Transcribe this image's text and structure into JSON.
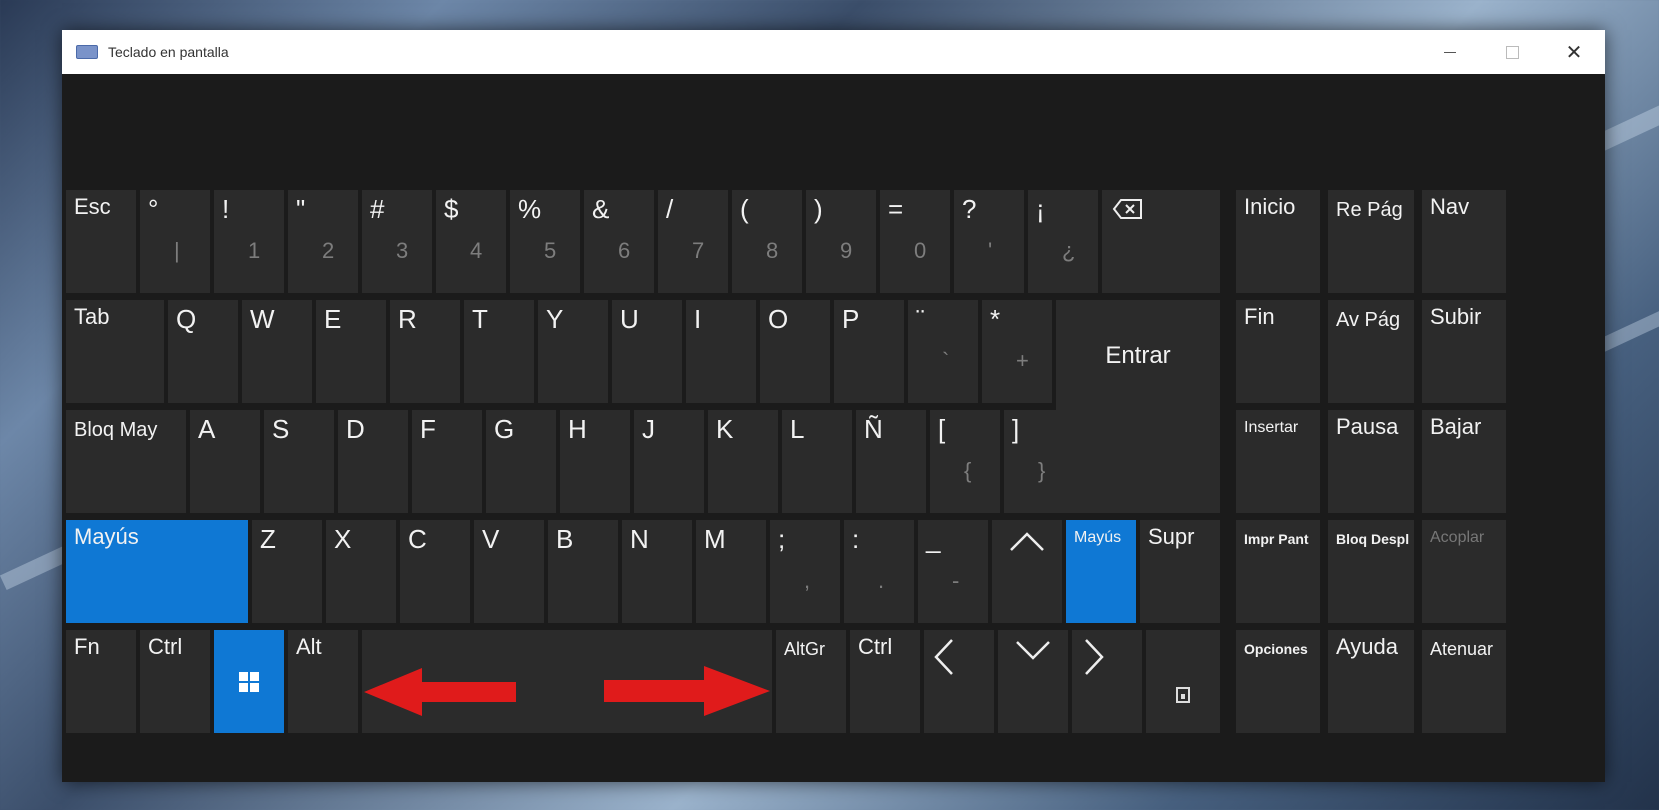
{
  "window": {
    "title": "Teclado en pantalla",
    "controls": {
      "minimize": "—",
      "maximize": "□",
      "close": "✕"
    }
  },
  "keys": {
    "esc": "Esc",
    "deg": "°",
    "deg_sub": "|",
    "excl": "!",
    "excl_sub": "1",
    "quote": "\"",
    "quote_sub": "2",
    "hash": "#",
    "hash_sub": "3",
    "dollar": "$",
    "dollar_sub": "4",
    "percent": "%",
    "percent_sub": "5",
    "amp": "&",
    "amp_sub": "6",
    "slash": "/",
    "slash_sub": "7",
    "lparen": "(",
    "lparen_sub": "8",
    "rparen": ")",
    "rparen_sub": "9",
    "equals": "=",
    "equals_sub": "0",
    "question": "?",
    "question_sub": "'",
    "iexcl": "¡",
    "iexcl_sub": "¿",
    "inicio": "Inicio",
    "repag": "Re Pág",
    "nav": "Nav",
    "tab": "Tab",
    "q": "Q",
    "w": "W",
    "e": "E",
    "r": "R",
    "t": "T",
    "y": "Y",
    "u": "U",
    "i": "I",
    "o": "O",
    "p": "P",
    "diaeresis": "¨",
    "diaeresis_sub": "`",
    "asterisk": "*",
    "asterisk_sub": "+",
    "entrar": "Entrar",
    "fin": "Fin",
    "avpag": "Av Pág",
    "subir": "Subir",
    "bloqmay": "Bloq May",
    "a": "A",
    "s": "S",
    "d": "D",
    "f": "F",
    "g": "G",
    "h": "H",
    "j": "J",
    "k": "K",
    "l": "L",
    "enye": "Ñ",
    "lbracket": "[",
    "lbracket_sub": "{",
    "rbracket": "]",
    "rbracket_sub": "}",
    "insertar": "Insertar",
    "pausa": "Pausa",
    "bajar": "Bajar",
    "mayus_left": "Mayús",
    "z": "Z",
    "x": "X",
    "c": "C",
    "v": "V",
    "b": "B",
    "n": "N",
    "m": "M",
    "semicolon": ";",
    "semicolon_sub": ",",
    "colon": ":",
    "colon_sub": ".",
    "underscore": "_",
    "underscore_sub": "-",
    "mayus_right": "Mayús",
    "supr": "Supr",
    "imprpant": "Impr Pant",
    "bloqdespl": "Bloq Despl",
    "acoplar": "Acoplar",
    "fn": "Fn",
    "ctrl_left": "Ctrl",
    "alt": "Alt",
    "altgr": "AltGr",
    "ctrl_right": "Ctrl",
    "opciones": "Opciones",
    "ayuda": "Ayuda",
    "atenuar": "Atenuar"
  },
  "colors": {
    "key_bg": "#2b2b2b",
    "accent": "#0f78d4",
    "arrow_red": "#e01b1b"
  }
}
